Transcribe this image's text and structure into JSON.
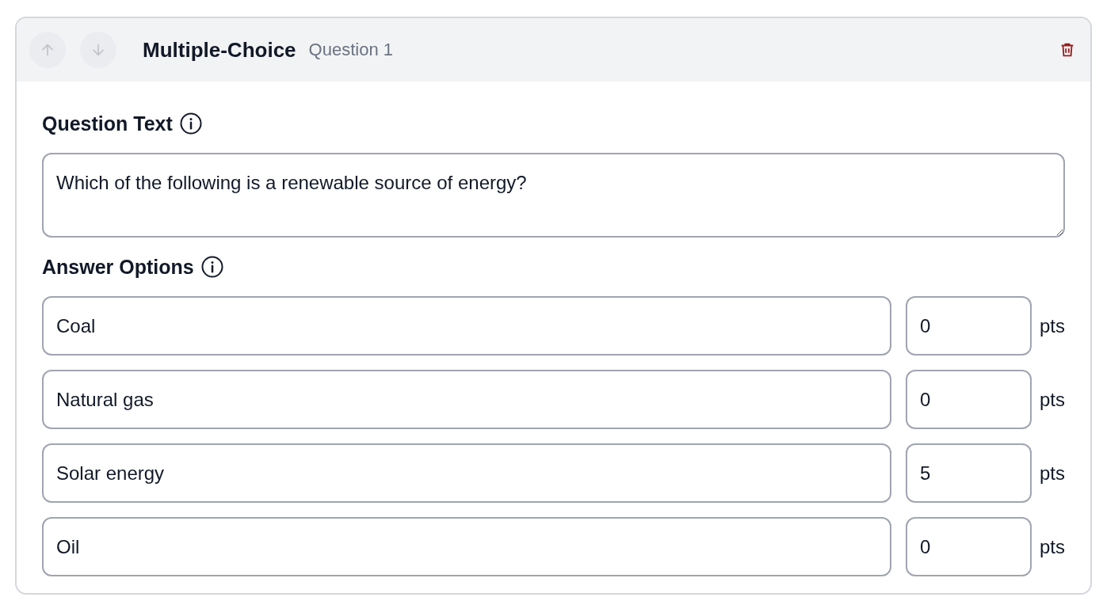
{
  "card": {
    "move_up": {
      "disabled": true
    },
    "move_down": {
      "disabled": true
    },
    "type": "Multiple-Choice",
    "subtitle": "Question 1"
  },
  "question_text": {
    "label": "Question Text",
    "value": "Which of the following is a renewable source of energy?"
  },
  "answer_options": {
    "label": "Answer Options",
    "options": [
      {
        "text": "Coal",
        "points": "0",
        "unit": "pts"
      },
      {
        "text": "Natural gas",
        "points": "0",
        "unit": "pts"
      },
      {
        "text": "Solar energy",
        "points": "5",
        "unit": "pts"
      },
      {
        "text": "Oil",
        "points": "0",
        "unit": "pts"
      }
    ]
  }
}
